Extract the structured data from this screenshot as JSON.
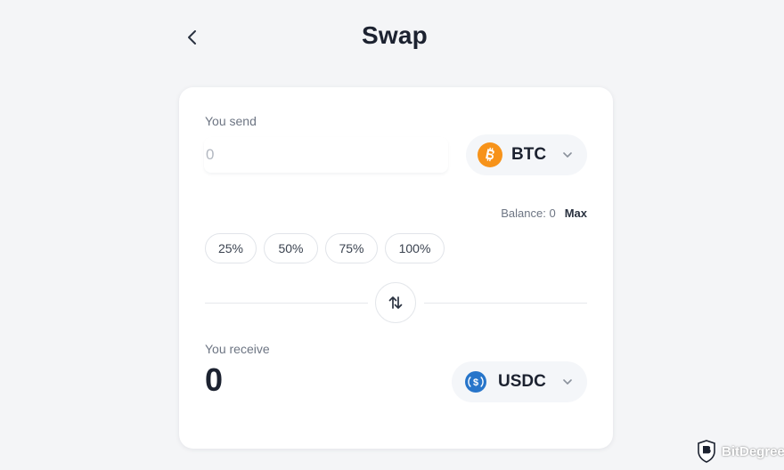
{
  "header": {
    "title": "Swap",
    "back_icon": "chevron-left-icon"
  },
  "send": {
    "label": "You send",
    "amount_placeholder": "0",
    "token": {
      "symbol": "BTC",
      "icon": "bitcoin-icon",
      "color": "#f7931a"
    },
    "balance_label": "Balance: 0",
    "max_label": "Max"
  },
  "percent_options": [
    "25%",
    "50%",
    "75%",
    "100%"
  ],
  "swap_direction_icon": "swap-vertical-arrows-icon",
  "receive": {
    "label": "You receive",
    "amount": "0",
    "token": {
      "symbol": "USDC",
      "icon": "usdc-icon",
      "color": "#2775ca"
    }
  },
  "watermark": {
    "text": "BitDegree"
  },
  "colors": {
    "background": "#f4f5f7",
    "card": "#ffffff",
    "text_primary": "#1c2230",
    "text_secondary": "#6d7583"
  }
}
